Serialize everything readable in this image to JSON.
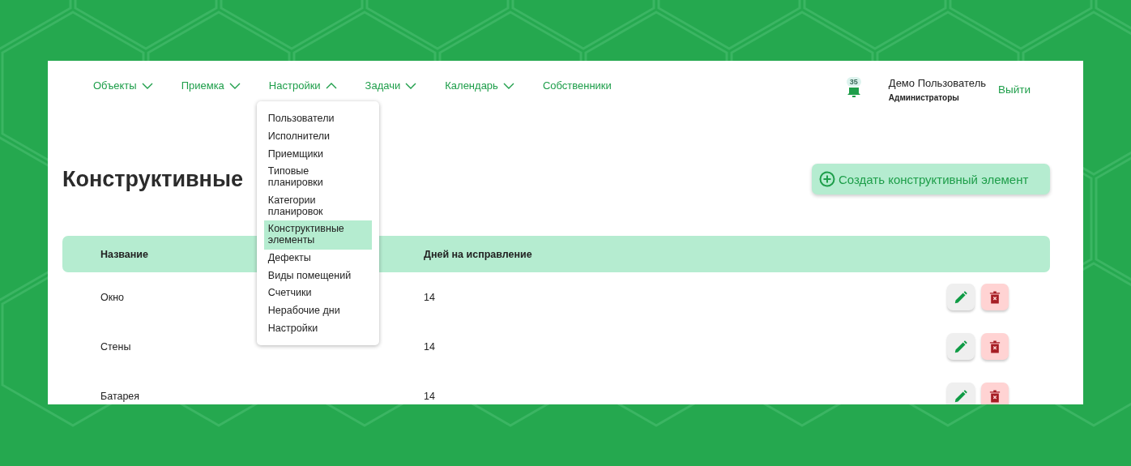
{
  "navigation": {
    "items": [
      {
        "label": "Объекты",
        "expanded": false,
        "has_menu": true
      },
      {
        "label": "Приемка",
        "expanded": false,
        "has_menu": true
      },
      {
        "label": "Настройки",
        "expanded": true,
        "has_menu": true
      },
      {
        "label": "Задачи",
        "expanded": false,
        "has_menu": true
      },
      {
        "label": "Календарь",
        "expanded": false,
        "has_menu": true
      },
      {
        "label": "Собственники",
        "has_menu": false
      }
    ]
  },
  "dropdown": {
    "items": [
      {
        "label": "Пользователи",
        "selected": false
      },
      {
        "label": "Исполнители",
        "selected": false
      },
      {
        "label": "Приемщики",
        "selected": false
      },
      {
        "label": "Типовые планировки",
        "selected": false
      },
      {
        "label": "Категории планировок",
        "selected": false
      },
      {
        "label": "Конструктивные элементы",
        "selected": true
      },
      {
        "label": "Дефекты",
        "selected": false
      },
      {
        "label": "Виды помещений",
        "selected": false
      },
      {
        "label": "Счетчики",
        "selected": false
      },
      {
        "label": "Нерабочие дни",
        "selected": false
      },
      {
        "label": "Настройки",
        "selected": false
      }
    ]
  },
  "notifications": {
    "count": "35"
  },
  "user": {
    "name": "Демо Пользователь",
    "role": "Администраторы",
    "logout": "Выйти"
  },
  "page": {
    "title": "Конструктивные",
    "create_button": "Создать конструктивный элемент"
  },
  "table": {
    "columns": [
      "Название",
      "Дней на исправление"
    ],
    "rows": [
      {
        "name": "Окно",
        "days": "14"
      },
      {
        "name": "Стены",
        "days": "14"
      },
      {
        "name": "Батарея",
        "days": "14"
      }
    ]
  }
}
